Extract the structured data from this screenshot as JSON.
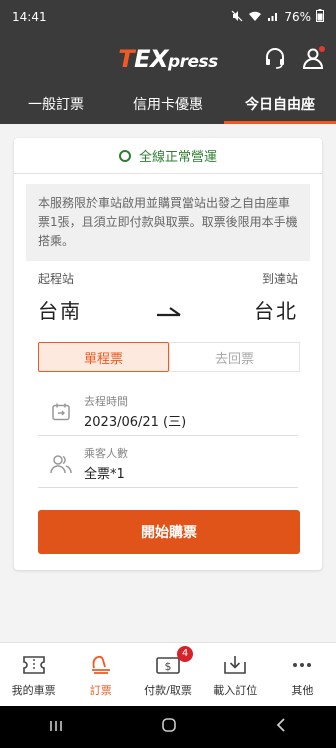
{
  "status_bar": {
    "time": "14:41",
    "battery": "76%"
  },
  "header": {
    "logo_t": "T",
    "logo_ex": "EX",
    "logo_press": "press"
  },
  "tabs": [
    {
      "label": "一般訂票",
      "active": false
    },
    {
      "label": "信用卡優惠",
      "active": false
    },
    {
      "label": "今日自由座",
      "active": true
    }
  ],
  "card": {
    "operation_status": "全線正常營運",
    "notice": "本服務限於車站啟用並購買當站出發之自由座車票1張，且須立即付款與取票。取票後限用本手機搭乘。",
    "departure_label": "起程站",
    "departure": "台南",
    "arrival_label": "到達站",
    "arrival": "台北",
    "trip_types": [
      {
        "label": "單程票",
        "selected": true
      },
      {
        "label": "去回票",
        "selected": false
      }
    ],
    "date_label": "去程時間",
    "date_value": "2023/06/21 (三)",
    "passenger_label": "乘客人數",
    "passenger_value": "全票*1",
    "buy_button": "開始購票"
  },
  "bottom_nav": [
    {
      "label": "我的車票",
      "icon": "ticket-icon",
      "active": false
    },
    {
      "label": "訂票",
      "icon": "seat-icon",
      "active": true
    },
    {
      "label": "付款/取票",
      "icon": "payment-icon",
      "active": false,
      "badge": "4"
    },
    {
      "label": "載入訂位",
      "icon": "download-icon",
      "active": false
    },
    {
      "label": "其他",
      "icon": "more-icon",
      "active": false
    }
  ],
  "colors": {
    "accent": "#ee5a22",
    "header_bg": "#3b3b3b",
    "status_green": "#2f7d32"
  }
}
